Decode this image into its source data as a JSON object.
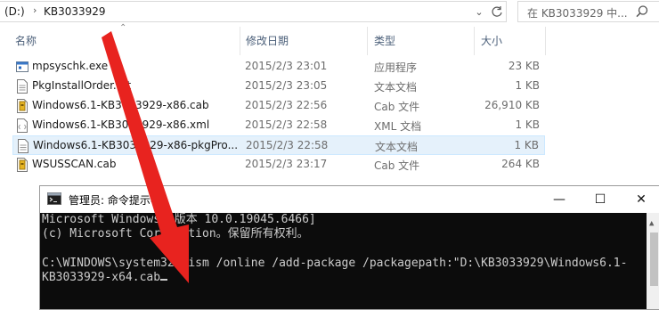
{
  "address_bar": {
    "crumb_drive": "(D:)",
    "crumb_folder": "KB3033929",
    "separator": "›"
  },
  "search": {
    "placeholder": "在 KB3033929 中..."
  },
  "columns": {
    "name": "名称",
    "date": "修改日期",
    "type": "类型",
    "size": "大小"
  },
  "files": [
    {
      "name": "mpsyschk.exe",
      "date": "2015/2/3 23:01",
      "type": "应用程序",
      "size": "23 KB",
      "icon": "exe-icon"
    },
    {
      "name": "PkgInstallOrder.txt",
      "date": "2015/2/3 23:05",
      "type": "文本文档",
      "size": "1 KB",
      "icon": "text-file-icon"
    },
    {
      "name": "Windows6.1-KB3033929-x86.cab",
      "date": "2015/2/3 22:56",
      "type": "Cab 文件",
      "size": "26,910 KB",
      "icon": "cab-file-icon"
    },
    {
      "name": "Windows6.1-KB3033929-x86.xml",
      "date": "2015/2/3 22:58",
      "type": "XML 文档",
      "size": "1 KB",
      "icon": "xml-file-icon"
    },
    {
      "name": "Windows6.1-KB3033929-x86-pkgPro...",
      "date": "2015/2/3 22:58",
      "type": "文本文档",
      "size": "1 KB",
      "icon": "text-file-icon"
    },
    {
      "name": "WSUSSCAN.cab",
      "date": "2015/2/3 23:17",
      "type": "Cab 文件",
      "size": "264 KB",
      "icon": "cab-file-icon"
    }
  ],
  "cmd": {
    "title": "管理员: 命令提示符",
    "lines": [
      "Microsoft Windows [版本 10.0.19045.6466]",
      "(c) Microsoft Corporation。保留所有权利。",
      "",
      "C:\\WINDOWS\\system32>dism /online /add-package /packagepath:\"D:\\KB3033929\\Windows6.1-",
      "KB3033929-x64.cab"
    ],
    "minimize": "—",
    "maximize": "☐",
    "close": "✕"
  },
  "colors": {
    "arrow": "#e8231f",
    "header_text": "#4c607a",
    "selection": "#e5f1fb",
    "console_bg": "#0c0c0c",
    "console_fg": "#cccccc"
  }
}
